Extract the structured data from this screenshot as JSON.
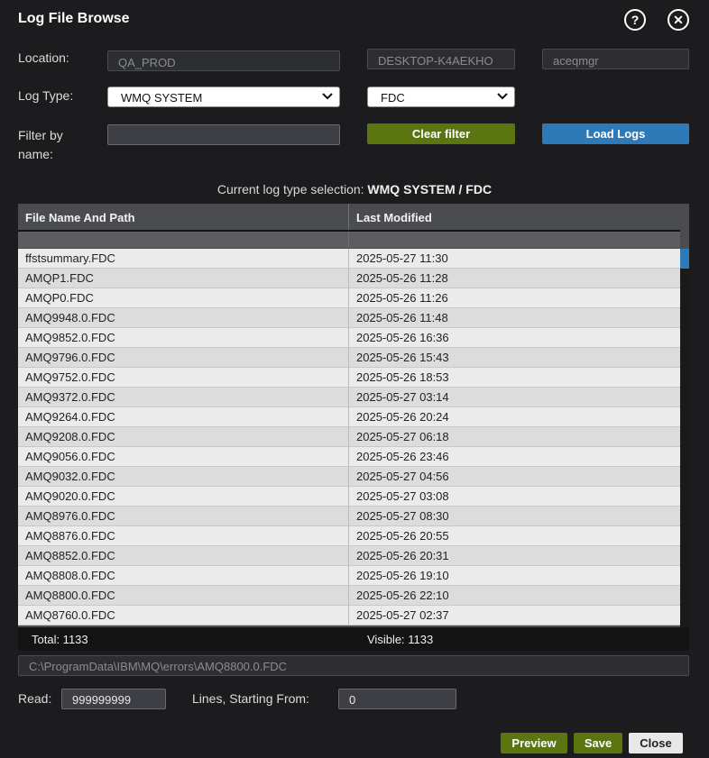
{
  "window": {
    "title": "Log File Browse",
    "help_icon": "question-circle-icon",
    "close_icon": "close-circle-icon"
  },
  "location": {
    "label": "Location:",
    "environment": "QA_PROD",
    "host": "DESKTOP-K4AEKHO",
    "queue_manager": "aceqmgr"
  },
  "log_type": {
    "label": "Log Type:",
    "category": "WMQ SYSTEM",
    "subtype": "FDC"
  },
  "filter": {
    "label": "Filter by name:",
    "value": "",
    "clear_label": "Clear filter",
    "load_label": "Load Logs"
  },
  "selection": {
    "prefix": "Current log type selection:",
    "value": "WMQ SYSTEM / FDC"
  },
  "table": {
    "columns": [
      "File Name And Path",
      "Last Modified"
    ],
    "rows": [
      [
        "ffstsummary.FDC",
        "2025-05-27 11:30"
      ],
      [
        "AMQP1.FDC",
        "2025-05-26 11:28"
      ],
      [
        "AMQP0.FDC",
        "2025-05-26 11:26"
      ],
      [
        "AMQ9948.0.FDC",
        "2025-05-26 11:48"
      ],
      [
        "AMQ9852.0.FDC",
        "2025-05-26 16:36"
      ],
      [
        "AMQ9796.0.FDC",
        "2025-05-26 15:43"
      ],
      [
        "AMQ9752.0.FDC",
        "2025-05-26 18:53"
      ],
      [
        "AMQ9372.0.FDC",
        "2025-05-27 03:14"
      ],
      [
        "AMQ9264.0.FDC",
        "2025-05-26 20:24"
      ],
      [
        "AMQ9208.0.FDC",
        "2025-05-27 06:18"
      ],
      [
        "AMQ9056.0.FDC",
        "2025-05-26 23:46"
      ],
      [
        "AMQ9032.0.FDC",
        "2025-05-27 04:56"
      ],
      [
        "AMQ9020.0.FDC",
        "2025-05-27 03:08"
      ],
      [
        "AMQ8976.0.FDC",
        "2025-05-27 08:30"
      ],
      [
        "AMQ8876.0.FDC",
        "2025-05-26 20:55"
      ],
      [
        "AMQ8852.0.FDC",
        "2025-05-26 20:31"
      ],
      [
        "AMQ8808.0.FDC",
        "2025-05-26 19:10"
      ],
      [
        "AMQ8800.0.FDC",
        "2025-05-26 22:10"
      ],
      [
        "AMQ8760.0.FDC",
        "2025-05-27 02:37"
      ]
    ],
    "total": "Total: 1133",
    "visible": "Visible: 1133"
  },
  "selected_path": "C:\\ProgramData\\IBM\\MQ\\errors\\AMQ8800.0.FDC",
  "read": {
    "label": "Read:",
    "value": "999999999",
    "lines_label": "Lines, Starting From:",
    "start_value": "0"
  },
  "actions": {
    "preview": "Preview",
    "save": "Save",
    "close": "Close"
  },
  "colors": {
    "background": "#1c1c1e",
    "green_button": "#5b7511",
    "blue_button": "#2e7ab8"
  }
}
